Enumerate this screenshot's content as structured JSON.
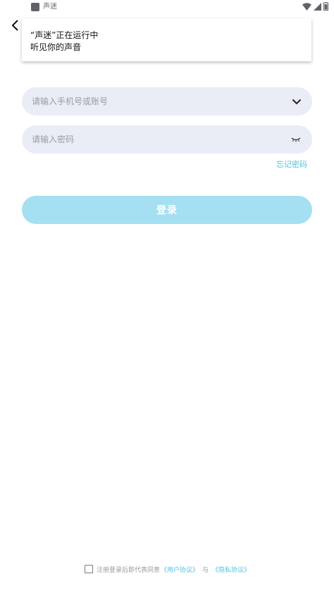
{
  "status_bar": {
    "app_name": "声迷"
  },
  "notification": {
    "title": "“声迷”正在运行中",
    "body": "听见你的声音"
  },
  "form": {
    "account_placeholder": "请输入手机号或账号",
    "password_placeholder": "请输入密码",
    "forgot_password": "忘记密码",
    "login_label": "登录"
  },
  "agreement": {
    "prefix": "注册登录后即代表同意",
    "user_agreement": "《用户协议》",
    "and": "与",
    "privacy_agreement": "《隐私协议》"
  },
  "colors": {
    "accent": "#55c0e0",
    "login_button": "#a5dff2",
    "input_background": "#eaecf6"
  }
}
